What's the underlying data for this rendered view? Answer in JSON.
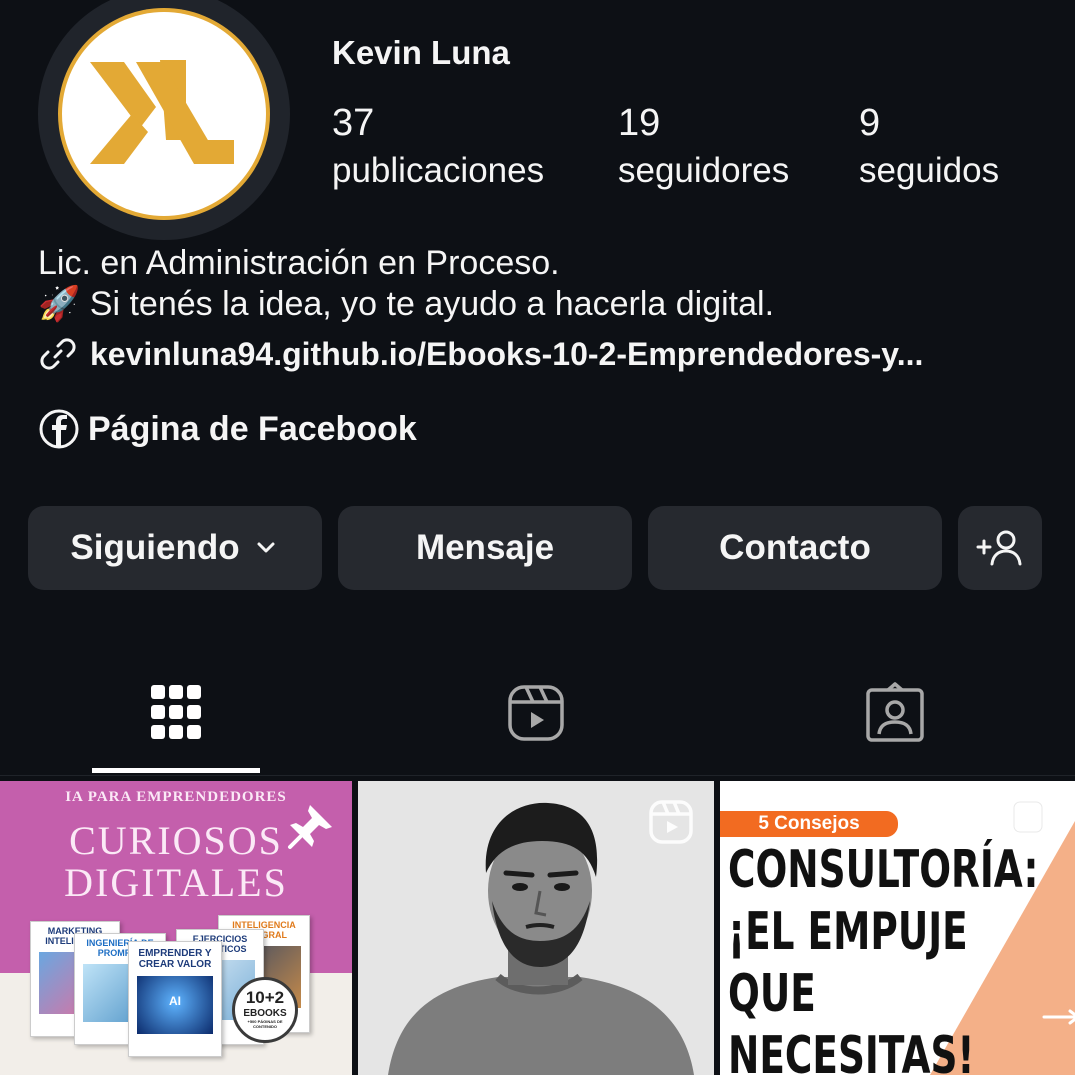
{
  "profile": {
    "username": "Kevin Luna",
    "avatar_logo": "KL",
    "stats": [
      {
        "value": "37",
        "label": "publicaciones"
      },
      {
        "value": "19",
        "label": "seguidores"
      },
      {
        "value": "9",
        "label": "seguidos"
      }
    ],
    "bio_line1": "Lic. en Administración en Proceso.",
    "bio_line2_emoji": "🚀",
    "bio_line2": "Si tenés la idea, yo te ayudo a hacerla digital.",
    "link": "kevinluna94.github.io/Ebooks-10-2-Emprendedores-y...",
    "facebook_label": "Página de Facebook"
  },
  "buttons": {
    "following": "Siguiendo",
    "message": "Mensaje",
    "contact": "Contacto"
  },
  "tabs": [
    {
      "name": "grid",
      "active": true
    },
    {
      "name": "reels",
      "active": false
    },
    {
      "name": "tagged",
      "active": false
    }
  ],
  "posts": {
    "post1": {
      "kicker": "IA PARA EMPRENDEDORES",
      "title_line1": "CURIOSOS",
      "title_line2": "DIGITALES",
      "books": [
        {
          "title": "MARKETING INTELIGENTE"
        },
        {
          "title": "INGENIERÍA DE PROMPTS"
        },
        {
          "title": "EMPRENDER Y CREAR VALOR"
        },
        {
          "title": "EJERCICIOS PRÁCTICOS"
        },
        {
          "title": "INTELIGENCIA INTEGRAL"
        }
      ],
      "seal_line1": "10+2",
      "seal_line2": "EBOOKS",
      "seal_line3": "+500 PÁGINAS DE CONTENIDO",
      "book_ai_badge": "AI"
    },
    "post3": {
      "badge": "5 Consejos",
      "line1": "CONSULTORÍA:",
      "line2": "¡EL EMPUJE",
      "line3": "QUE",
      "line4": "NECESITAS!"
    }
  },
  "colors": {
    "background": "#0d1015",
    "button_bg": "#26292f",
    "logo_gold": "#e3a935",
    "post1_bg": "#c45fac",
    "post3_badge": "#f26b21",
    "post3_accent": "#f4b088"
  }
}
